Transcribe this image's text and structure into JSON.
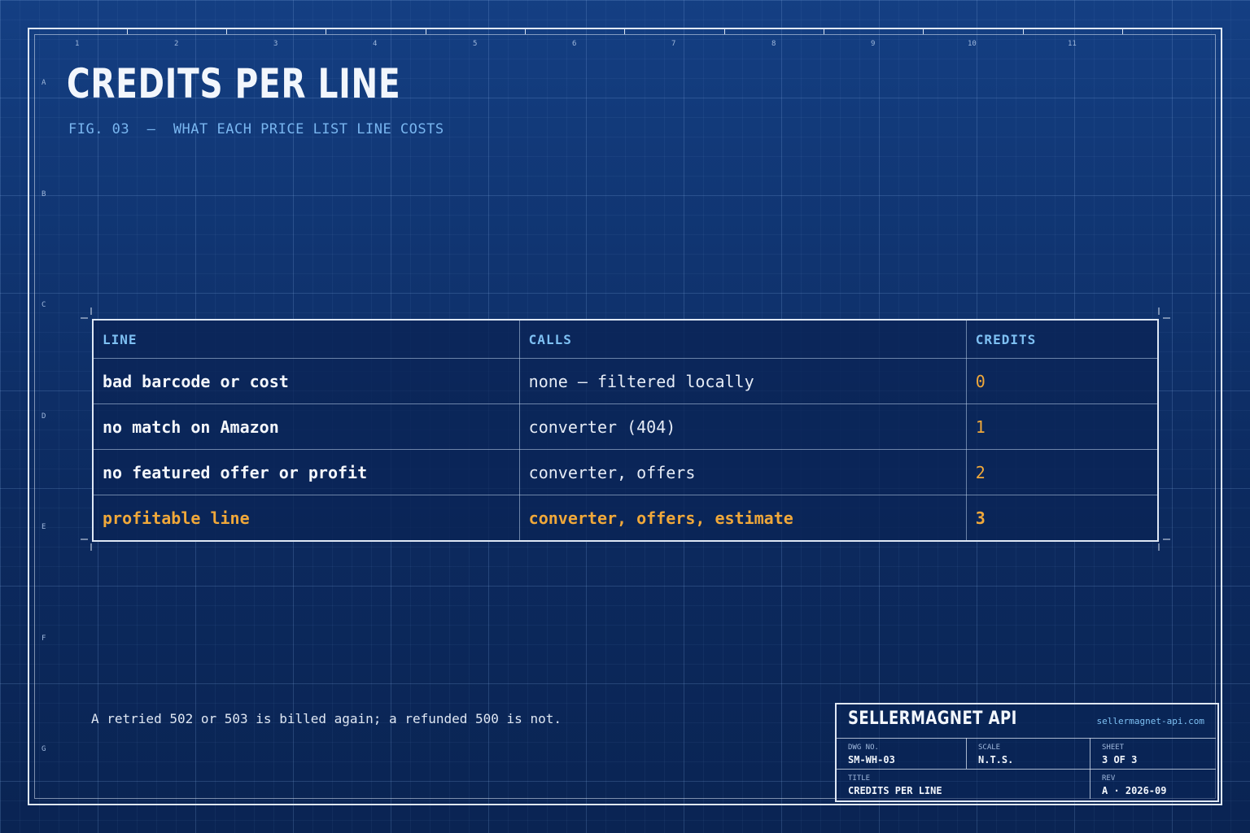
{
  "header": {
    "title": "CREDITS PER LINE",
    "subtitle": "FIG. 03  —  WHAT EACH PRICE LIST LINE COSTS"
  },
  "grid": {
    "columns": [
      "1",
      "2",
      "3",
      "4",
      "5",
      "6",
      "7",
      "8",
      "9",
      "10",
      "11"
    ],
    "rows": [
      "A",
      "B",
      "C",
      "D",
      "E",
      "F",
      "G"
    ]
  },
  "table": {
    "headers": [
      "LINE",
      "CALLS",
      "CREDITS"
    ],
    "rows": [
      {
        "line": "bad barcode or cost",
        "calls": "none — filtered locally",
        "credits": "0"
      },
      {
        "line": "no match on Amazon",
        "calls": "converter (404)",
        "credits": "1"
      },
      {
        "line": "no featured offer or profit",
        "calls": "converter, offers",
        "credits": "2"
      },
      {
        "line": "profitable line",
        "calls": "converter, offers, estimate",
        "credits": "3"
      }
    ]
  },
  "note": "A retried 502 or 503 is billed again; a refunded 500 is not.",
  "title_block": {
    "brand": "SELLERMAGNET API",
    "url": "sellermagnet-api.com",
    "dwg_no_label": "DWG NO.",
    "dwg_no": "SM-WH-03",
    "scale_label": "SCALE",
    "scale": "N.T.S.",
    "sheet_label": "SHEET",
    "sheet": "3 OF 3",
    "title_label": "TITLE",
    "title": "CREDITS PER LINE",
    "rev_label": "REV",
    "rev": "A · 2026-09"
  },
  "colors": {
    "background": "#0d2d63",
    "accent_blue": "#7ec0f3",
    "accent_orange": "#f0a83a",
    "frame": "#dfe8f5"
  }
}
